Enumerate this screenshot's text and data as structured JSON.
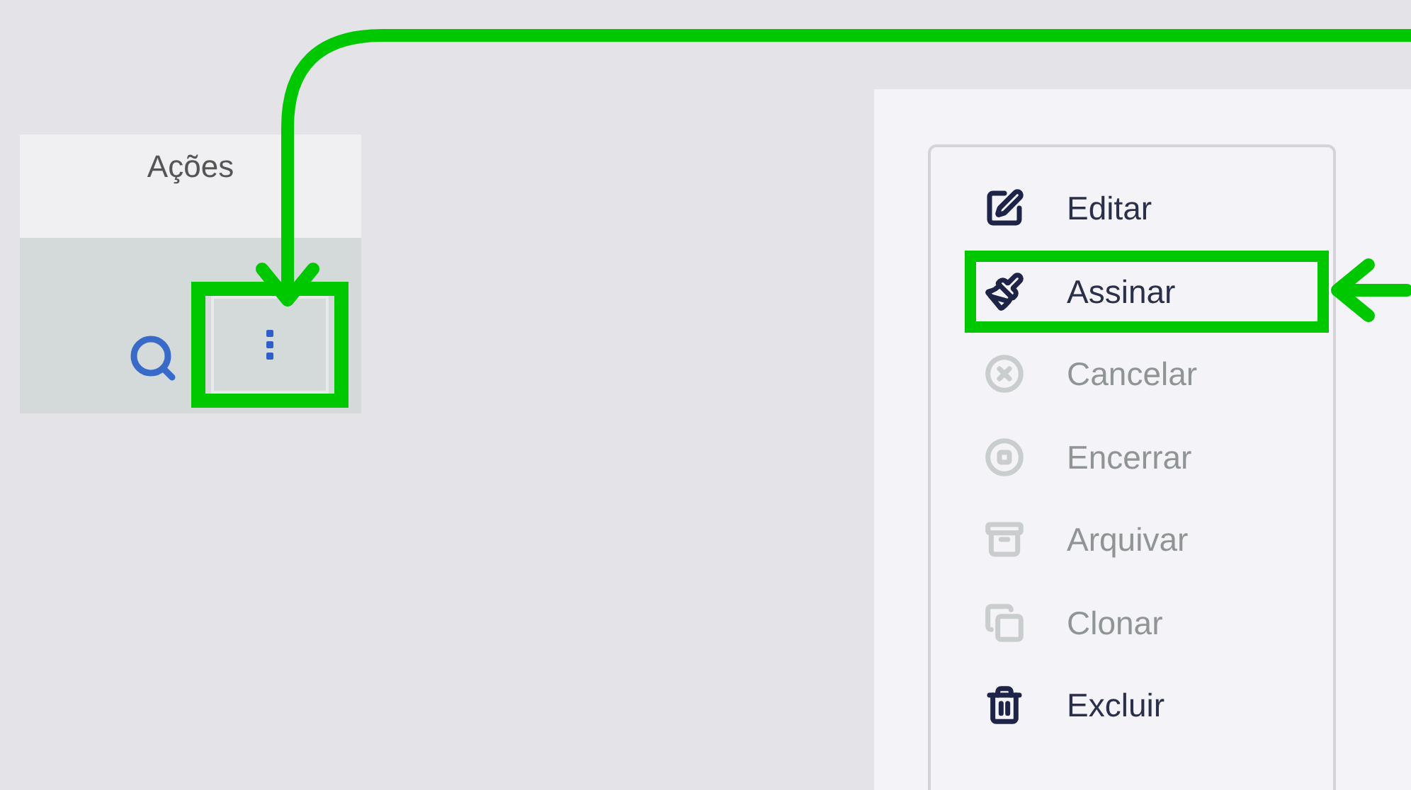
{
  "table": {
    "header": "Ações",
    "row": {
      "actions_button": {
        "highlighted": true
      }
    }
  },
  "menu": {
    "items": [
      {
        "label": "Editar",
        "disabled": false,
        "highlighted": false
      },
      {
        "label": "Assinar",
        "disabled": false,
        "highlighted": true
      },
      {
        "label": "Cancelar",
        "disabled": true,
        "highlighted": false
      },
      {
        "label": "Encerrar",
        "disabled": true,
        "highlighted": false
      },
      {
        "label": "Arquivar",
        "disabled": true,
        "highlighted": false
      },
      {
        "label": "Clonar",
        "disabled": true,
        "highlighted": false
      },
      {
        "label": "Excluir",
        "disabled": false,
        "highlighted": false
      }
    ]
  }
}
